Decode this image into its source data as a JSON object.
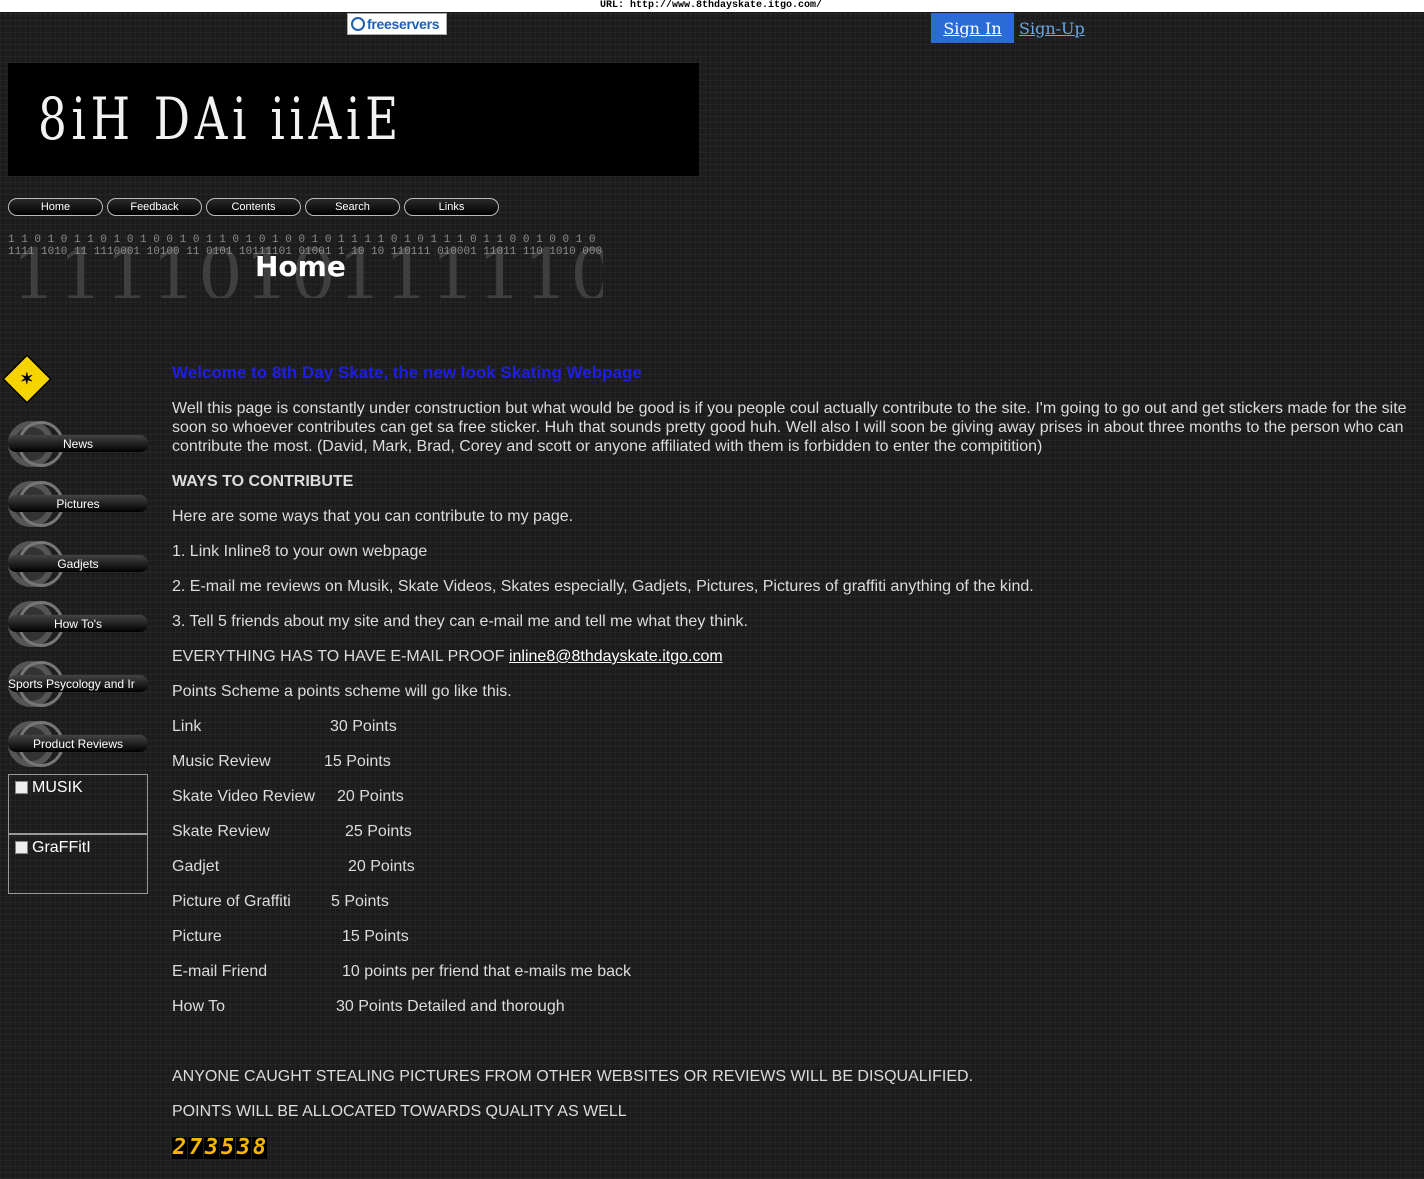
{
  "url_label": "URL: http://www.8thdayskate.itgo.com/",
  "freeservers": {
    "label": "freeservers"
  },
  "auth": {
    "sign_in": "Sign In",
    "sign_up": "Sign-Up"
  },
  "banner": {
    "title": "8iH DAi iiAiE"
  },
  "nav": [
    "Home",
    "Feedback",
    "Contents",
    "Search",
    "Links"
  ],
  "headline": {
    "title": "Home",
    "binary_big": "11110101111101(",
    "binary_small_1": "1 1 0 1 0 1 1 0 1 0 1 0 0 1 0 1 1 0 1 0 1 0 0 1 0 1 1 1 1 0 1 0 1 1 1 0 1 1 0 0 1 0 0 1 0",
    "binary_small_2": "1111 1010 11 1110001 10100 11 0101 10111101 01001 1 10 10 110111 010001 11011 110 1010 0001 1"
  },
  "sidebar": {
    "buttons": [
      "News",
      "Pictures",
      "Gadjets",
      "How To's",
      "Sports Psycology and Ir",
      "Product Reviews"
    ],
    "boxes": [
      "MUSIK",
      "GraFFitI"
    ]
  },
  "main": {
    "welcome": "Welcome to 8th Day Skate, the new look Skating Webpage",
    "intro": "Well this page is constantly under construction but what would be good is if you people coul actually contribute to the site. I'm going to go out and get stickers made for the site soon so whoever contributes can get sa free sticker. Huh that sounds pretty good huh. Well also I will soon be giving away prises in about three months to the person who can contribute the most. (David, Mark, Brad, Corey and scott or anyone affiliated with them is forbidden to enter the compitition)",
    "ways_heading": "WAYS TO CONTRIBUTE",
    "ways_intro": "Here are some ways that you can contribute to my page.",
    "way1": "1. Link Inline8  to your own webpage",
    "way2": "2. E-mail me reviews on Musik, Skate Videos, Skates especially, Gadjets, Pictures, Pictures of graffiti anything of the kind.",
    "way3": "3. Tell 5 friends about my site and they can e-mail me and tell me what they think.",
    "proof_text": "EVERYTHING HAS TO HAVE E-MAIL PROOF ",
    "proof_email": "inline8@8thdayskate.itgo.com",
    "scheme": "Points Scheme a points scheme will go like this.",
    "points": [
      {
        "label": "Link",
        "value": "30 Points"
      },
      {
        "label": "Music Review",
        "value": "15 Points"
      },
      {
        "label": "Skate Video Review",
        "value": "20 Points"
      },
      {
        "label": "Skate Review",
        "value": "25 Points"
      },
      {
        "label": "Gadjet",
        "value": "20 Points"
      },
      {
        "label": "Picture of Graffiti",
        "value": "5 Points"
      },
      {
        "label": "Picture",
        "value": "15 Points"
      },
      {
        "label": "E-mail Friend",
        "value": "10 points per friend that e-mails me back"
      },
      {
        "label": "How To",
        "value": "30 Points Detailed and thorough"
      }
    ],
    "warning1": "ANYONE CAUGHT STEALING PICTURES FROM OTHER WEBSITES OR REVIEWS WILL BE DISQUALIFIED.",
    "warning2": "POINTS WILL BE ALLOCATED TOWARDS QUALITY AS WELL"
  },
  "counter": [
    "2",
    "7",
    "3",
    "5",
    "3",
    "8"
  ]
}
